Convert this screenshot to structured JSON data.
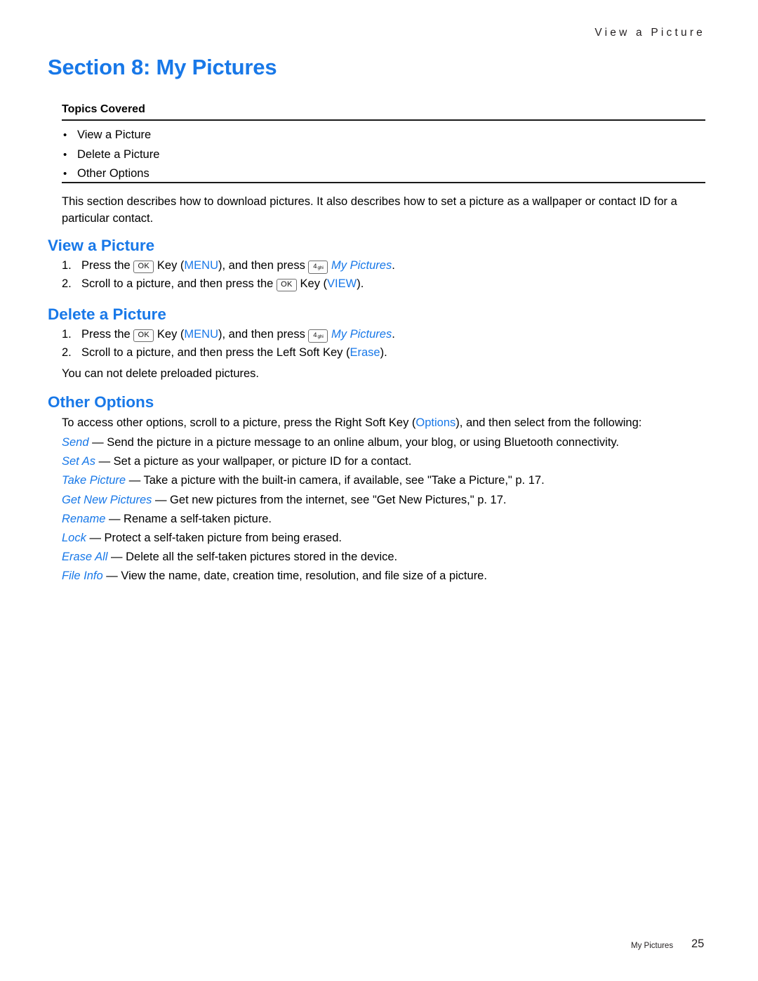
{
  "header": {
    "running_head": "View a Picture"
  },
  "section": {
    "title": "Section 8:  My Pictures"
  },
  "topics": {
    "label": "Topics Covered",
    "bullet_glyph": "•",
    "items": [
      "View a Picture",
      "Delete a Picture",
      "Other Options"
    ]
  },
  "intro": {
    "text": "This section describes how to download pictures. It also describes how to set a picture as a wallpaper or contact ID for a particular contact."
  },
  "keys": {
    "ok_label": "OK",
    "four_label": "4",
    "four_sub": "ghi"
  },
  "view_picture": {
    "heading": "View a Picture",
    "steps": [
      {
        "num": "1.",
        "pre": "Press the",
        "key": "ok",
        "mid": "Key (",
        "action": "MENU",
        "mid2": "), and then press",
        "key2": "four",
        "target": "My Pictures",
        "post": "."
      },
      {
        "num": "2.",
        "pre": "Scroll to a picture, and then press the",
        "key": "ok",
        "mid": "Key (",
        "action": "VIEW",
        "post": ")."
      }
    ]
  },
  "delete_picture": {
    "heading": "Delete a Picture",
    "steps": [
      {
        "num": "1.",
        "pre": "Press the",
        "key": "ok",
        "mid": "Key (",
        "action": "MENU",
        "mid2": "), and then press",
        "key2": "four",
        "target": "My Pictures",
        "post": "."
      },
      {
        "num": "2.",
        "pre": "Scroll to a picture, and then press the Left Soft Key (",
        "action": "Erase",
        "post": ")."
      }
    ],
    "note": "You can not delete preloaded pictures."
  },
  "other_options": {
    "heading": "Other Options",
    "intro_pre": "To access other options, scroll to a picture, press the Right Soft Key (",
    "intro_link": "Options",
    "intro_post": "), and then select from the following:",
    "items": [
      {
        "term": "Send",
        "desc": "— Send the picture in a picture message to an online album, your blog, or using Bluetooth connectivity."
      },
      {
        "term": "Set As",
        "desc": "— Set a picture as your wallpaper, or picture ID for a contact."
      },
      {
        "term": "Take Picture",
        "desc": "— Take a picture with the built-in camera, if available, see \"Take a Picture,\" p. 17."
      },
      {
        "term": "Get New Pictures",
        "desc": "— Get new pictures from the internet, see \"Get New Pictures,\" p. 17."
      },
      {
        "term": "Rename",
        "desc": "— Rename a self-taken picture."
      },
      {
        "term": "Lock",
        "desc": "— Protect a self-taken picture from being erased."
      },
      {
        "term": "Erase All",
        "desc": "— Delete all the self-taken pictures stored in the device."
      },
      {
        "term": "File Info",
        "desc": "— View the name, date, creation time, resolution, and file size of a picture."
      }
    ]
  },
  "footer": {
    "label": "My Pictures",
    "page": "25"
  },
  "colors": {
    "accent_blue": "#1878e8",
    "text_black": "#000000",
    "rule": "#1a1a1a"
  }
}
